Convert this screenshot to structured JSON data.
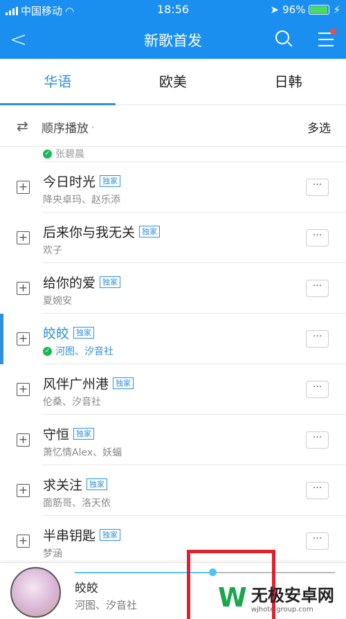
{
  "status": {
    "carrier": "中国移动",
    "time": "18:56",
    "battery": "96%",
    "battery_level": 0.96
  },
  "nav": {
    "title": "新歌首发",
    "back_icon": "chevron-left-icon",
    "search_icon": "search-icon",
    "menu_icon": "menu-icon",
    "notification_color": "#f5484a"
  },
  "tabs": [
    {
      "label": "华语",
      "active": true
    },
    {
      "label": "欧美"
    },
    {
      "label": "日韩"
    }
  ],
  "toolbar": {
    "play_mode": "顺序播放",
    "multi_select": "多选"
  },
  "partial_row": {
    "artist": "张碧晨"
  },
  "songs": [
    {
      "title": "今日时光",
      "badge": "独家",
      "artist": "降央卓玛、赵乐添"
    },
    {
      "title": "后来你与我无关",
      "badge": "独家",
      "artist": "欢子"
    },
    {
      "title": "给你的爱",
      "badge": "独家",
      "artist": "夏婉安"
    },
    {
      "title": "皎皎",
      "badge": "独家",
      "artist": "河图、汐音社",
      "playing": true
    },
    {
      "title": "风伴广州港",
      "badge": "独家",
      "artist": "伦桑、汐音社"
    },
    {
      "title": "守恒",
      "badge": "独家",
      "artist": "萧忆情Alex、妖蝠"
    },
    {
      "title": "求关注",
      "badge": "独家",
      "artist": "面筋哥、洛天依"
    },
    {
      "title": "半串钥匙",
      "badge": "独家",
      "artist": "梦涵"
    }
  ],
  "player": {
    "title": "皎皎",
    "artist": "河图、汐音社",
    "progress": 0.53
  },
  "watermark": {
    "name": "无极安卓网",
    "url": "wjhotelgroup.com"
  },
  "colors": {
    "accent": "#1a8ff0",
    "tab_active": "#2f8fd8",
    "check": "#19b955",
    "progress": "#4fc3f7"
  }
}
